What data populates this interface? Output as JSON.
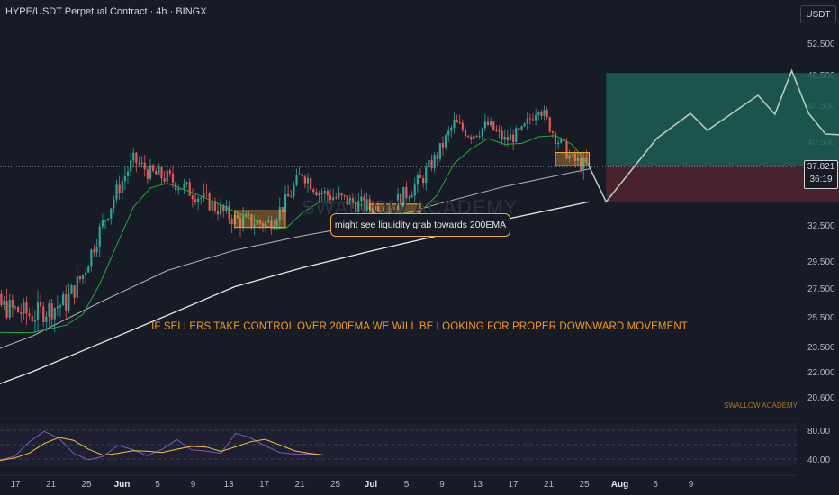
{
  "header": {
    "title": "HYPE/USDT Perpetual Contract · 4h · BINGX",
    "unit": "USDT"
  },
  "price_tag": {
    "price": "37.821",
    "countdown": "36:19"
  },
  "annotations": {
    "callout": "might see liquidity grab towards 200EMA",
    "headline": "IF SELLERS TAKE CONTROL OVER 200EMA WE WILL BE LOOKING FOR PROPER DOWNWARD MOVEMENT",
    "watermark_big": "SWALLOW ACADEMY",
    "watermark_small": "SWALLOW ACADEMY"
  },
  "colors": {
    "background": "#171b26",
    "candle_up": "#26a69a",
    "candle_down": "#ef5350",
    "ema_200": "#e8e8e8",
    "ema_short": "#26a63a",
    "ema_mid": "#ef5350",
    "highlight_box": "#f2a93b",
    "target_zone": "#1b5e55",
    "stop_zone": "#5a2530",
    "projection": "#b7c9bd",
    "rsi_line": "#7e57c2",
    "rsi_ma": "#f5c242"
  },
  "chart_data": {
    "type": "candlestick",
    "title": "HYPE/USDT Perpetual Contract · 4h · BINGX",
    "y_unit": "USDT",
    "y_ticks": [
      "52.500",
      "48.500",
      "44.500",
      "40.500",
      "32.500",
      "29.500",
      "27.500",
      "25.500",
      "23.500",
      "22.000",
      "20.600"
    ],
    "x_ticks": [
      "17",
      "21",
      "25",
      "Jun",
      "5",
      "9",
      "13",
      "17",
      "21",
      "25",
      "Jul",
      "5",
      "9",
      "13",
      "17",
      "21",
      "25",
      "Aug",
      "5",
      "9"
    ],
    "last_price": 37.821,
    "price_path": [
      {
        "date": "May 14",
        "price": 25.0
      },
      {
        "date": "May 16",
        "price": 26.3
      },
      {
        "date": "May 18",
        "price": 25.6
      },
      {
        "date": "May 20",
        "price": 26.5
      },
      {
        "date": "May 21",
        "price": 28.5
      },
      {
        "date": "May 22",
        "price": 32.0
      },
      {
        "date": "May 23",
        "price": 35.5
      },
      {
        "date": "May 24",
        "price": 38.5
      },
      {
        "date": "May 25",
        "price": 37.2
      },
      {
        "date": "May 26",
        "price": 36.8
      },
      {
        "date": "May 28",
        "price": 35.0
      },
      {
        "date": "May 30",
        "price": 33.0
      },
      {
        "date": "Jun 1",
        "price": 32.6
      },
      {
        "date": "Jun 2",
        "price": 34.5
      },
      {
        "date": "Jun 3",
        "price": 37.3
      },
      {
        "date": "Jun 4",
        "price": 35.5
      },
      {
        "date": "Jun 6",
        "price": 34.5
      },
      {
        "date": "Jun 8",
        "price": 33.8
      },
      {
        "date": "Jun 10",
        "price": 36.5
      },
      {
        "date": "Jun 11",
        "price": 39.0
      },
      {
        "date": "Jun 12",
        "price": 42.5
      },
      {
        "date": "Jun 13",
        "price": 41.2
      },
      {
        "date": "Jun 14",
        "price": 42.3
      },
      {
        "date": "Jun 15",
        "price": 40.6
      },
      {
        "date": "Jun 16",
        "price": 41.5
      },
      {
        "date": "Jun 17",
        "price": 44.5
      },
      {
        "date": "Jun 18",
        "price": 41.0
      },
      {
        "date": "Jun 19",
        "price": 38.5
      },
      {
        "date": "Jun 20",
        "price": 37.8
      }
    ],
    "ema_200": [
      {
        "date": "May 14",
        "price": 20.6
      },
      {
        "date": "May 18",
        "price": 22.0
      },
      {
        "date": "May 22",
        "price": 23.7
      },
      {
        "date": "May 26",
        "price": 25.6
      },
      {
        "date": "May 30",
        "price": 27.6
      },
      {
        "date": "Jun 3",
        "price": 29.0
      },
      {
        "date": "Jun 7",
        "price": 30.3
      },
      {
        "date": "Jun 11",
        "price": 31.6
      },
      {
        "date": "Jun 15",
        "price": 33.0
      },
      {
        "date": "Jun 20",
        "price": 34.6
      }
    ],
    "ema_mid": [
      {
        "date": "May 14",
        "price": 22.6
      },
      {
        "date": "May 18",
        "price": 24.2
      },
      {
        "date": "May 22",
        "price": 26.5
      },
      {
        "date": "May 26",
        "price": 28.8
      },
      {
        "date": "May 30",
        "price": 30.4
      },
      {
        "date": "Jun 3",
        "price": 31.6
      },
      {
        "date": "Jun 7",
        "price": 32.6
      },
      {
        "date": "Jun 11",
        "price": 34.4
      },
      {
        "date": "Jun 15",
        "price": 36.0
      },
      {
        "date": "Jun 20",
        "price": 37.6
      }
    ],
    "trade_box": {
      "start": "Jun 21",
      "end": "Jul 5",
      "target": 48.7,
      "entry": 37.821,
      "stop": 34.6
    },
    "projection": [
      {
        "date": "Jun 20",
        "price": 37.8
      },
      {
        "date": "Jun 21",
        "price": 34.6
      },
      {
        "date": "Jun 24",
        "price": 40.8
      },
      {
        "date": "Jun 26",
        "price": 43.6
      },
      {
        "date": "Jun 27",
        "price": 41.7
      },
      {
        "date": "Jun 30",
        "price": 45.8
      },
      {
        "date": "Jul 1",
        "price": 43.5
      },
      {
        "date": "Jul 2",
        "price": 49.0
      },
      {
        "date": "Jul 3",
        "price": 43.6
      },
      {
        "date": "Jul 4",
        "price": 41.3
      },
      {
        "date": "Jul 5",
        "price": 41.2
      },
      {
        "date": "Jul 6",
        "price": 40.0
      },
      {
        "date": "Jul 7",
        "price": 43.6
      },
      {
        "date": "Jul 8",
        "price": 42.5
      },
      {
        "date": "Jul 10",
        "price": 47.8
      }
    ],
    "highlight_zones": [
      {
        "start": "May 30",
        "end": "Jun 2",
        "top": 33.8,
        "bottom": 32.3
      },
      {
        "start": "Jun 7",
        "end": "Jun 10",
        "top": 34.4,
        "bottom": 33.5
      },
      {
        "start": "Jun 18",
        "end": "Jun 20",
        "top": 39.3,
        "bottom": 37.9
      }
    ],
    "rsi": {
      "ticks": [
        "80.00",
        "40.00"
      ],
      "values": [
        38,
        45,
        62,
        78,
        70,
        50,
        41,
        45,
        58,
        52,
        43,
        52,
        66,
        55,
        49,
        48,
        74,
        70,
        58,
        51,
        45,
        48,
        44
      ]
    }
  }
}
